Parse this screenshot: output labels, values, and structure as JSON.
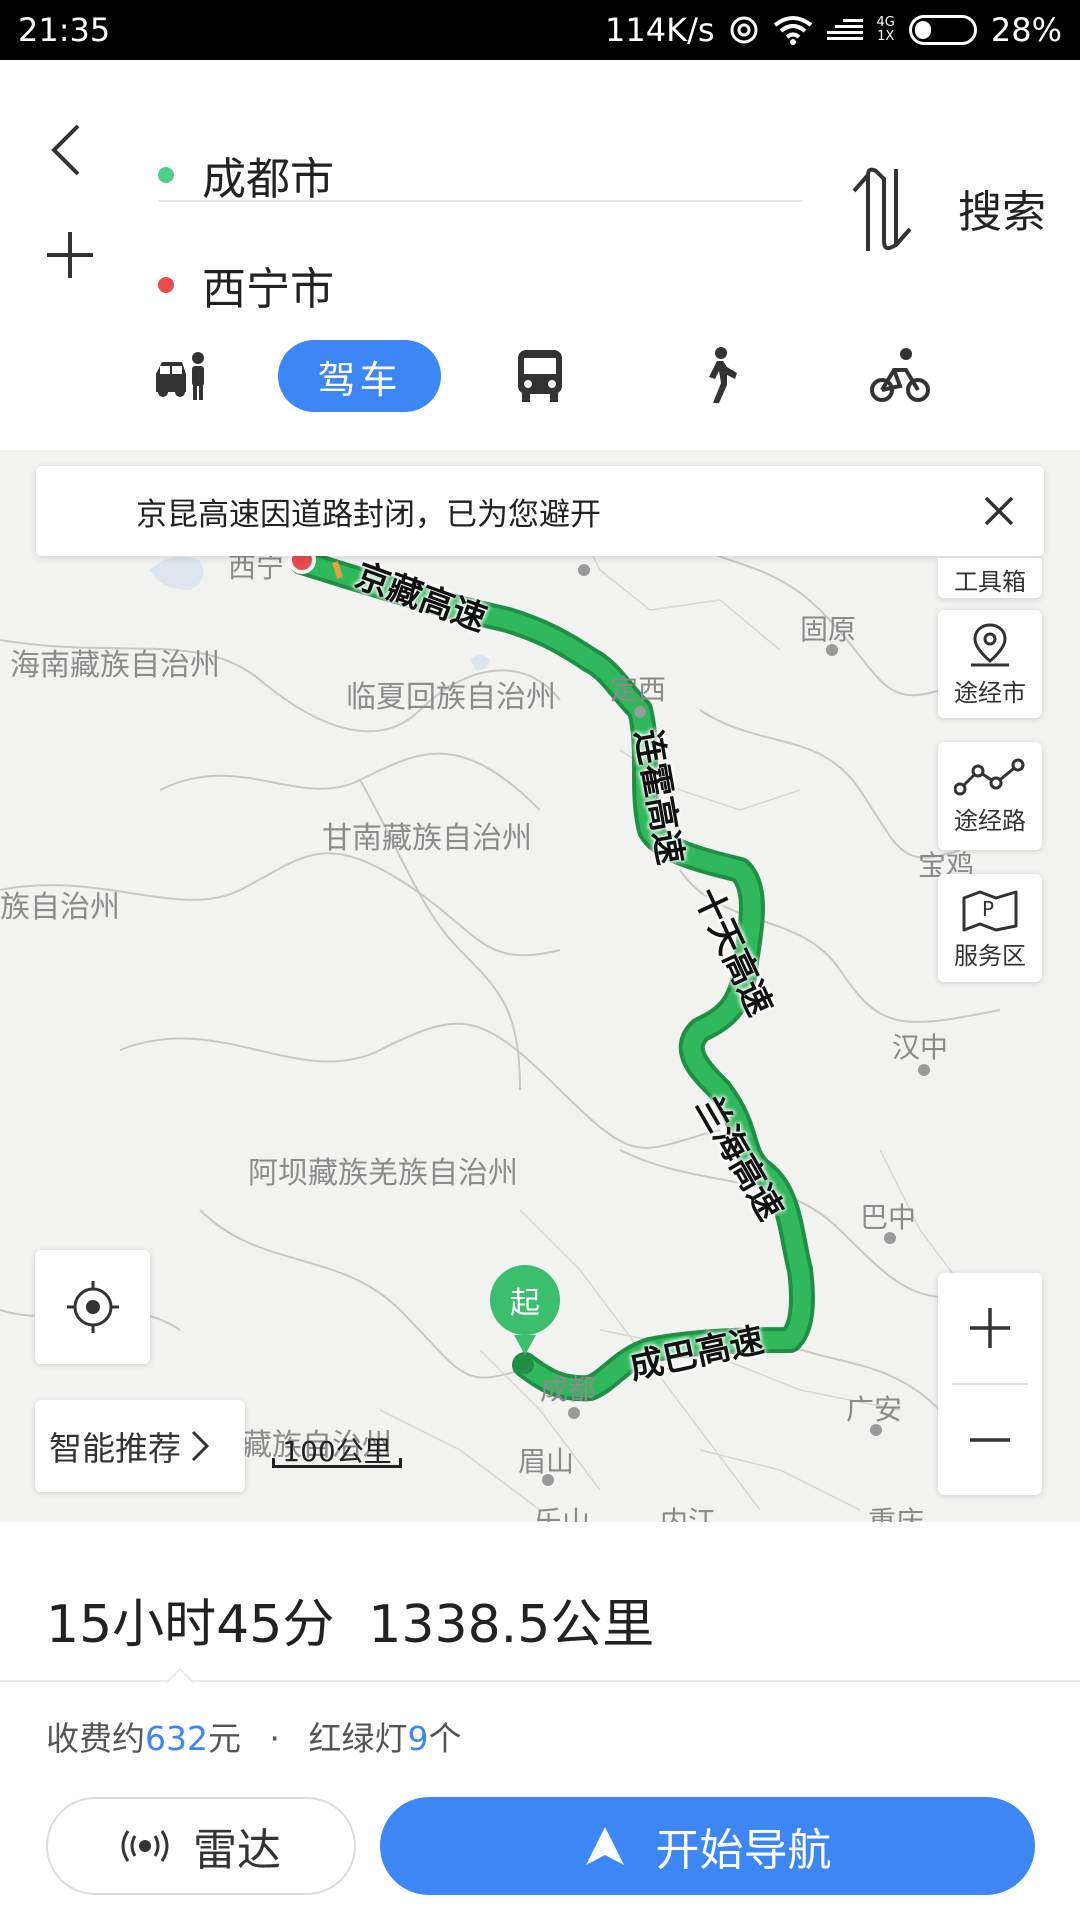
{
  "status_bar": {
    "time": "21:35",
    "speed": "114K/s",
    "net_top": "4G",
    "net_bottom": "1X",
    "battery": "28%",
    "battery_level": 0.28
  },
  "route": {
    "start": "成都市",
    "end": "西宁市",
    "start_color": "#4ccf8a",
    "end_color": "#e84c4c",
    "search_label": "搜索"
  },
  "modes": {
    "selected": "驾车"
  },
  "notice": {
    "text": "京昆高速因道路封闭，已为您避开"
  },
  "map": {
    "regions": [
      "海南藏族自治州",
      "临夏回族自治州",
      "甘南藏族自治州",
      "族自治州",
      "阿坝藏族羌族自治州",
      "藏族自治州"
    ],
    "cities": [
      "西宁",
      "固原",
      "定西",
      "宝鸡",
      "汉中",
      "巴中",
      "成都",
      "广安",
      "眉山",
      "乐山",
      "内江",
      "重庆"
    ],
    "roads": [
      "京藏高速",
      "连霍高速",
      "十天高速",
      "兰海高速",
      "成巴高速"
    ],
    "side_buttons": {
      "toolbox": "工具箱",
      "via_city": "途经市",
      "via_road": "途经路",
      "service_area": "服务区"
    },
    "smart_recommend": "智能推荐",
    "scale": "100公里",
    "start_marker": "起",
    "route_color": "#2fb85c"
  },
  "summary": {
    "duration": "15小时45分",
    "distance": "1338.5公里"
  },
  "fees": {
    "toll_prefix": "收费约",
    "toll_amount": "632",
    "toll_unit": "元",
    "separator": "·",
    "lights_prefix": "红绿灯",
    "lights_count": "9",
    "lights_unit": "个"
  },
  "actions": {
    "radar": "雷达",
    "navigate": "开始导航"
  }
}
